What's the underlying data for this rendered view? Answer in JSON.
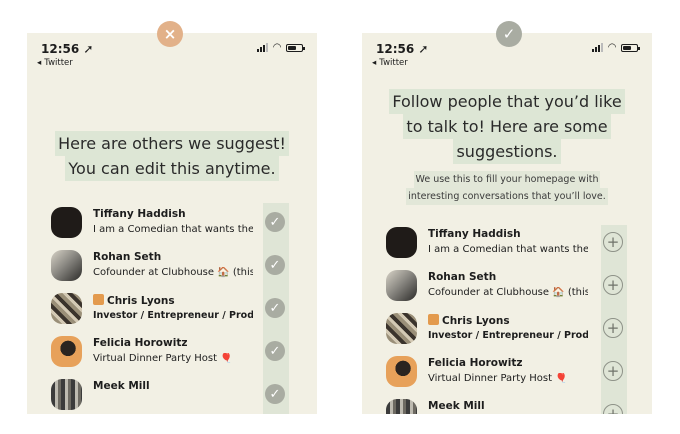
{
  "left": {
    "badge_icon": "×",
    "status": {
      "time": "12:56 ➚",
      "back": "Twitter"
    },
    "heading_lines": [
      "Here are others we suggest!",
      "You can edit this anytime."
    ],
    "users": [
      {
        "name": "Tiffany Haddish",
        "bio": "I am a Comedian that wants the...",
        "bio_bold": false,
        "action": "✓"
      },
      {
        "name": "Rohan Seth",
        "bio": "Cofounder at Clubhouse 🏠 (this...",
        "bio_bold": false,
        "action": "✓"
      },
      {
        "name": "Chris Lyons",
        "bio": "Investor / Entrepreneur / Producer...",
        "bio_bold": true,
        "action": "✓"
      },
      {
        "name": "Felicia Horowitz",
        "bio": "Virtual Dinner Party Host 🎈",
        "bio_bold": false,
        "action": "✓"
      },
      {
        "name": "Meek Mill",
        "bio": "",
        "bio_bold": false,
        "action": "✓"
      }
    ]
  },
  "right": {
    "badge_icon": "✓",
    "status": {
      "time": "12:56 ➚",
      "back": "Twitter"
    },
    "heading_lines": [
      "Follow people that you’d like",
      "to talk to! Here are some",
      "suggestions."
    ],
    "sub_lines": [
      "We use this to fill your homepage with",
      "interesting conversations that you’ll love."
    ],
    "users": [
      {
        "name": "Tiffany Haddish",
        "bio": "I am a Comedian that wants the...",
        "bio_bold": false,
        "action": "+"
      },
      {
        "name": "Rohan Seth",
        "bio": "Cofounder at Clubhouse 🏠 (this...",
        "bio_bold": false,
        "action": "+"
      },
      {
        "name": "Chris Lyons",
        "bio": "Investor / Entrepreneur / Producer...",
        "bio_bold": true,
        "action": "+"
      },
      {
        "name": "Felicia Horowitz",
        "bio": "Virtual Dinner Party Host 🎈",
        "bio_bold": false,
        "action": "+"
      },
      {
        "name": "Meek Mill",
        "bio": "",
        "bio_bold": false,
        "action": "+"
      }
    ]
  },
  "colors": {
    "background": "#f2f0e4",
    "highlight": "#dde6d5",
    "check": "#a9aca2",
    "badge_left": "#e2b189"
  }
}
